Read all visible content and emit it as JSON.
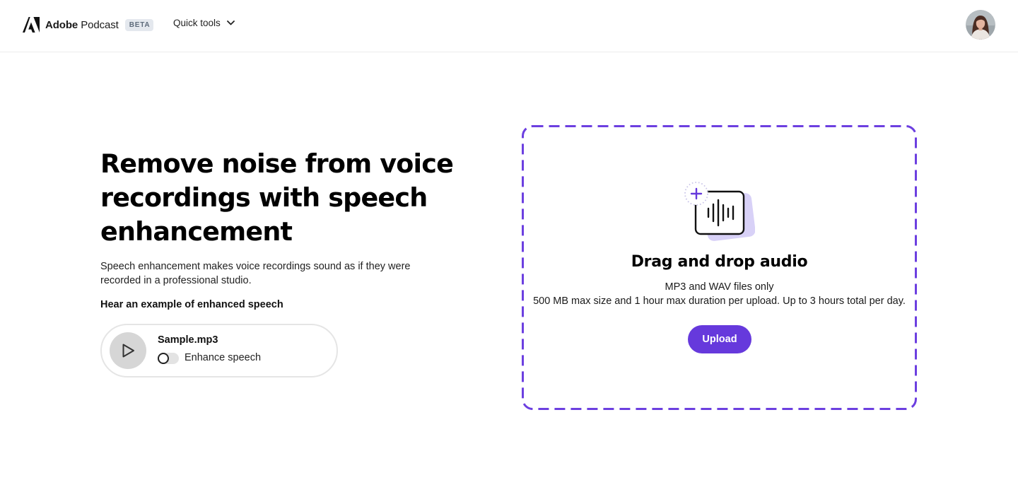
{
  "header": {
    "brand_name_bold": "Adobe",
    "brand_name_rest": "Podcast",
    "beta_badge": "BETA",
    "quick_tools_label": "Quick tools"
  },
  "hero": {
    "title": "Remove noise from voice recordings with speech enhancement",
    "description": "Speech enhancement makes voice recordings sound as if they were recorded in a professional studio.",
    "example_heading": "Hear an example of enhanced speech",
    "sample": {
      "file_name": "Sample.mp3",
      "toggle_label": "Enhance speech",
      "toggle_on": false
    }
  },
  "dropzone": {
    "title": "Drag and drop audio",
    "formats": "MP3 and WAV files only",
    "limits": "500 MB max size and 1 hour max duration per upload. Up to 3 hours total per day.",
    "upload_label": "Upload"
  },
  "colors": {
    "accent": "#6639dc",
    "dropzone_border": "#6c3fe0",
    "beta_badge_bg": "#e4e8ee",
    "play_button_bg": "#d6d6d6"
  },
  "icons": {
    "brand": "adobe-logo-icon",
    "dropdown": "chevron-down-icon",
    "play": "play-icon",
    "audio": "audio-waveform-icon",
    "add": "plus-icon"
  }
}
